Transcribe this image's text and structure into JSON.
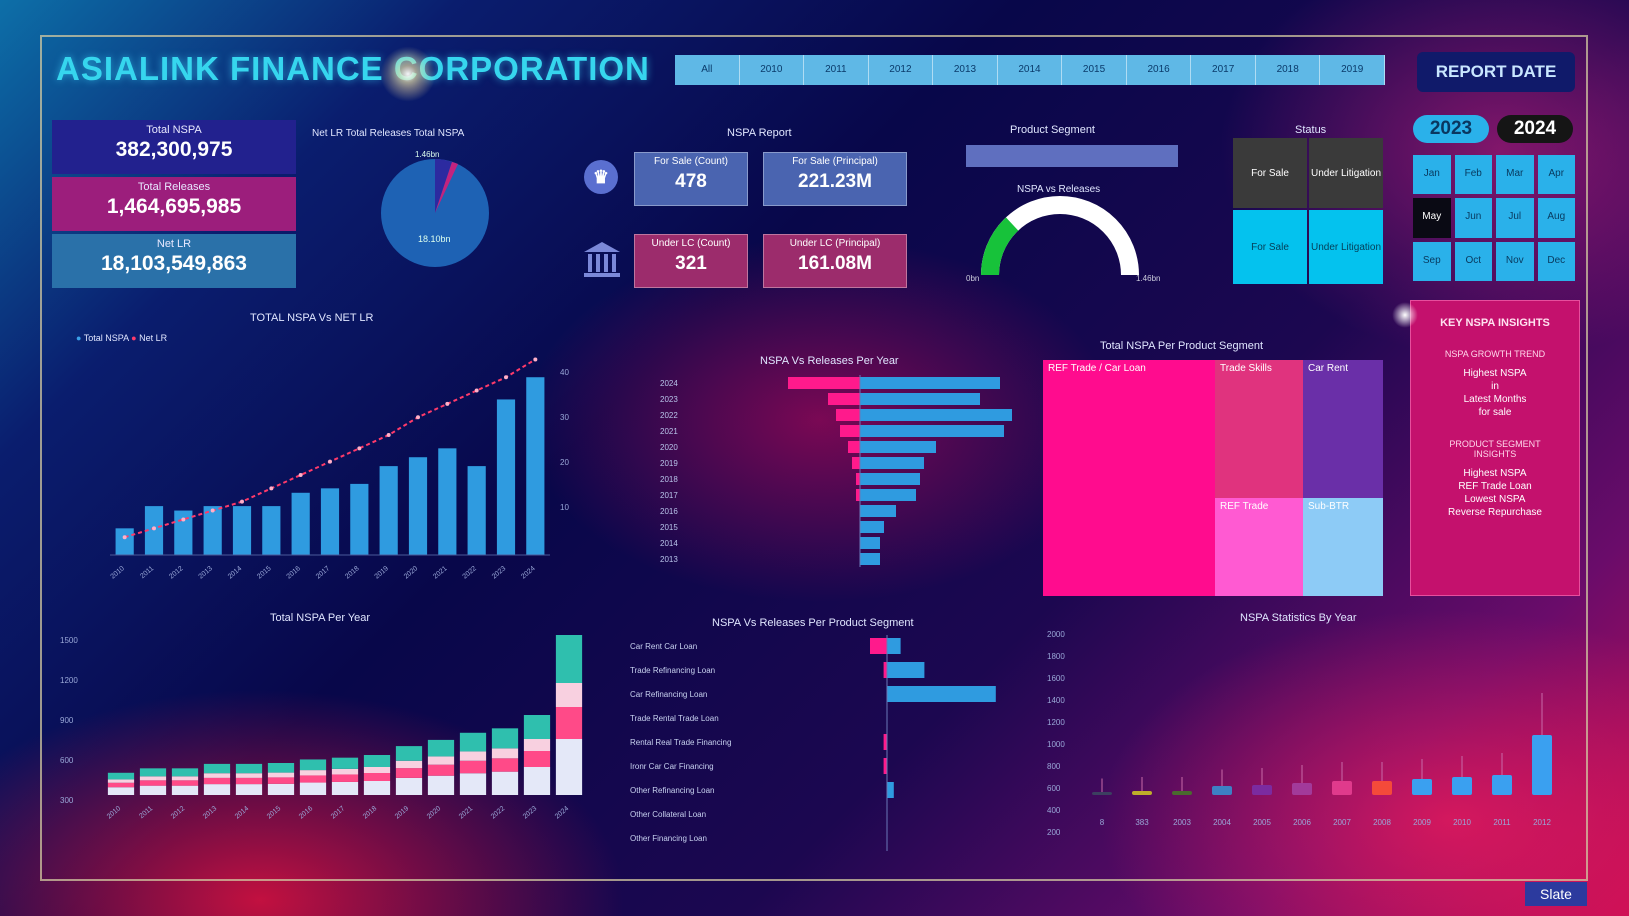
{
  "header": {
    "title": "ASIALINK FINANCE CORPORATION",
    "year_tabs": [
      "All",
      "2010",
      "2011",
      "2012",
      "2013",
      "2014",
      "2015",
      "2016",
      "2017",
      "2018",
      "2019"
    ],
    "report_date_label": "REPORT DATE"
  },
  "kpis": [
    {
      "label": "Total NSPA",
      "value": "382,300,975",
      "color": "#22218e"
    },
    {
      "label": "Total Releases",
      "value": "1,464,695,985",
      "color": "#9c1e7c"
    },
    {
      "label": "Net LR",
      "value": "18,103,549,863",
      "color": "#2a71a9"
    }
  ],
  "donut": {
    "legend": "Net LR  Total Releases  Total NSPA",
    "top_label": "1.46bn",
    "main_label": "18.10bn"
  },
  "nspa_report": {
    "title": "NSPA Report",
    "cards": [
      {
        "label": "For Sale (Count)",
        "value": "478",
        "color": "#4a64b0"
      },
      {
        "label": "For Sale (Principal)",
        "value": "221.23M",
        "color": "#4a64b0"
      },
      {
        "label": "Under LC (Count)",
        "value": "321",
        "color": "#9c2c6c"
      },
      {
        "label": "Under LC (Principal)",
        "value": "161.08M",
        "color": "#9c2c6c"
      }
    ]
  },
  "product_segment": {
    "title": "Product Segment"
  },
  "gauge": {
    "title": "NSPA vs Releases",
    "min_label": "0bn",
    "max_label": "1.46bn",
    "fraction": 0.26
  },
  "status": {
    "title": "Status",
    "cells": [
      "For Sale",
      "Under Litigation",
      "For Sale",
      "Under Litigation"
    ]
  },
  "year_buttons": [
    {
      "label": "2023",
      "bg": "#2ab1ea",
      "fg": "#0a3760"
    },
    {
      "label": "2024",
      "bg": "#151515",
      "fg": "#ffffff"
    }
  ],
  "months": [
    "Jan",
    "Feb",
    "Mar",
    "Apr",
    "May",
    "Jun",
    "Jul",
    "Aug",
    "Sep",
    "Oct",
    "Nov",
    "Dec"
  ],
  "selected_month": "May",
  "pink_panel": {
    "title": "KEY NSPA INSIGHTS",
    "sub1": "NSPA GROWTH TREND",
    "p1": "Highest NSPA\nin\nLatest Months\nfor sale",
    "sub2": "PRODUCT SEGMENT\nINSIGHTS",
    "p2": "Highest NSPA\nREF Trade Loan\nLowest NSPA\nReverse Repurchase"
  },
  "treemap": {
    "title": "Total NSPA Per Product Segment",
    "blocks": [
      {
        "label": "REF Trade / Car Loan",
        "color": "#ff0c8e"
      },
      {
        "label": "Trade Skills",
        "color": "#e0337e"
      },
      {
        "label": "Car Rent",
        "color": "#6a2fa8"
      },
      {
        "label": "REF Trade",
        "color": "#ff5ad2"
      },
      {
        "label": "Sub-BTR",
        "color": "#8dcbf6"
      }
    ]
  },
  "charts": {
    "nspa_vs_netlr": {
      "title": "TOTAL NSPA Vs NET LR",
      "legend": [
        "Total NSPA",
        "Net LR"
      ]
    },
    "nspa_vs_release_year": {
      "title": "NSPA Vs Releases Per Year"
    },
    "nspa_per_year": {
      "title": "Total NSPA Per Year"
    },
    "nspa_vs_release_segment": {
      "title": "NSPA Vs Releases Per Product Segment"
    },
    "nspa_statistics": {
      "title": "NSPA Statistics By Year"
    }
  },
  "chart_data": [
    {
      "type": "bar",
      "title": "TOTAL NSPA Vs NET LR",
      "categories": [
        "2010",
        "2011",
        "2012",
        "2013",
        "2014",
        "2015",
        "2016",
        "2017",
        "2018",
        "2019",
        "2020",
        "2021",
        "2022",
        "2023",
        "2024"
      ],
      "series": [
        {
          "name": "Total NSPA",
          "values": [
            6,
            11,
            10,
            11,
            11,
            11,
            14,
            15,
            16,
            20,
            22,
            24,
            20,
            35,
            40
          ]
        },
        {
          "name": "Net LR",
          "values": [
            4,
            6,
            8,
            10,
            12,
            15,
            18,
            21,
            24,
            27,
            31,
            34,
            37,
            40,
            44
          ]
        }
      ]
    },
    {
      "type": "bar",
      "title": "NSPA Vs Releases Per Year",
      "categories": [
        "2024",
        "2023",
        "2022",
        "2021",
        "2020",
        "2019",
        "2018",
        "2017",
        "2016",
        "2015",
        "2014",
        "2013"
      ],
      "series": [
        {
          "name": "NSPA",
          "values": [
            -18,
            -8,
            -6,
            -5,
            -3,
            -2,
            -1,
            -1,
            0,
            0,
            0,
            0
          ]
        },
        {
          "name": "Releases",
          "values": [
            35,
            30,
            38,
            36,
            19,
            16,
            15,
            14,
            9,
            6,
            5,
            5
          ]
        }
      ]
    },
    {
      "type": "bar",
      "title": "Total NSPA Per Year",
      "categories": [
        "2010",
        "2011",
        "2012",
        "2013",
        "2014",
        "2015",
        "2016",
        "2017",
        "2018",
        "2019",
        "2020",
        "2021",
        "2022",
        "2023",
        "2024"
      ],
      "series": [
        {
          "name": "Total NSPA",
          "values": [
            25,
            30,
            30,
            35,
            35,
            36,
            40,
            42,
            45,
            55,
            62,
            70,
            75,
            90,
            180
          ]
        }
      ]
    },
    {
      "type": "bar",
      "title": "NSPA Vs Releases Per Product Segment",
      "categories": [
        "Car Rent Car Loan",
        "Trade Refinancing Loan",
        "Car Refinancing Loan",
        "Trade Rental Trade Loan",
        "Rental Real Trade Financing",
        "Ironr Car Car Financing",
        "Other Refinancing Loan",
        "Other Collateral Loan",
        "Other Financing Loan"
      ],
      "series": [
        {
          "name": "NSPA",
          "values": [
            -5,
            -1,
            0,
            0,
            -1,
            -1,
            0,
            0,
            0
          ]
        },
        {
          "name": "Releases",
          "values": [
            4,
            11,
            32,
            0,
            0,
            0,
            2,
            0,
            0
          ]
        }
      ]
    },
    {
      "type": "box",
      "title": "NSPA Statistics By Year",
      "ylabels": [
        "2000",
        "1800",
        "1600",
        "1400",
        "1200",
        "1000",
        "800",
        "600",
        "400",
        "200"
      ],
      "categories": [
        "8",
        "383",
        "2003",
        "2004",
        "2005",
        "2006",
        "2007",
        "2008",
        "2009",
        "2010",
        "2011",
        "2012"
      ],
      "colors": [
        "#3c3f60",
        "#bfae2a",
        "#4a6a2e",
        "#3d80c4",
        "#7b2ba0",
        "#a23a9a",
        "#e03a8c",
        "#f44a3a",
        "#3aa0f0",
        "#3aa0f0",
        "#3aa0f0",
        "#3aa0f0"
      ]
    }
  ],
  "slate_label": "Slate"
}
